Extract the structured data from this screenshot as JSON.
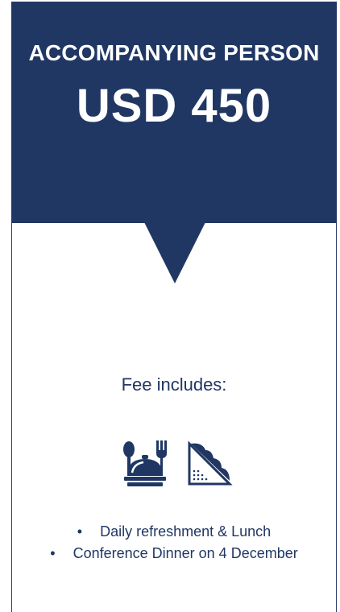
{
  "header": {
    "title": "ACCOMPANYING PERSON",
    "price": "USD 450"
  },
  "fee": {
    "heading": "Fee includes:",
    "icons": [
      "meal-dome-cutlery-icon",
      "sandwich-icon"
    ],
    "items": [
      "Daily refreshment & Lunch",
      "Conference Dinner on 4 December"
    ],
    "bullet": "•"
  },
  "colors": {
    "brand_navy": "#203764",
    "text_navy": "#203764",
    "background": "#ffffff"
  }
}
